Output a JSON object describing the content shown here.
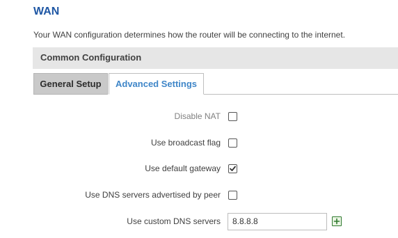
{
  "page": {
    "title": "WAN",
    "description": "Your WAN configuration determines how the router will be connecting to the internet."
  },
  "section": {
    "title": "Common Configuration"
  },
  "tabs": [
    {
      "label": "General Setup",
      "active": false
    },
    {
      "label": "Advanced Settings",
      "active": true
    }
  ],
  "fields": {
    "disable_nat": {
      "label": "Disable NAT",
      "checked": false
    },
    "broadcast_flag": {
      "label": "Use broadcast flag",
      "checked": false
    },
    "default_gateway": {
      "label": "Use default gateway",
      "checked": true
    },
    "peer_dns": {
      "label": "Use DNS servers advertised by peer",
      "checked": false
    },
    "custom_dns": {
      "label": "Use custom DNS servers",
      "value": "8.8.8.8"
    }
  },
  "colors": {
    "title": "#1f57a4",
    "active_tab": "#3f86c8",
    "add_button": "#2f7a2f"
  },
  "icons": {
    "checkmark": "check-icon",
    "add": "plus-icon"
  }
}
